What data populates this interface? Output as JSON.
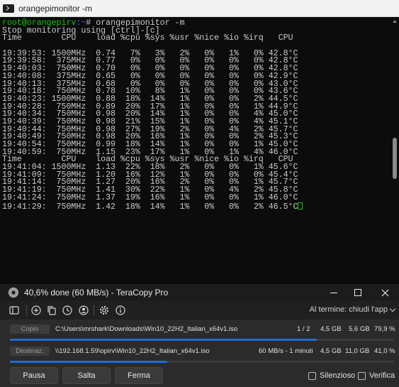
{
  "terminal": {
    "title": "orangepimonitor -m",
    "prompt_user": "root@orangepirv",
    "prompt_path": ":~",
    "prompt_symbol": "#",
    "command": "orangepimonitor -m",
    "lines": [
      "Stop monitoring using [ctrl]-[c]",
      "Time        CPU    load %cpu %sys %usr %nice %io %irq   CPU",
      "",
      "19:39:53: 1500MHz  0.74   7%   3%   2%   0%   1%   0% 42.8°C",
      "19:39:58:  375MHz  0.77   0%   0%   0%   0%   0%   0% 42.8°C",
      "19:40:03:  750MHz  0.70   0%   0%   0%   0%   0%   0% 42.8°C",
      "19:40:08:  375MHz  0.65   0%   0%   0%   0%   0%   0% 42.9°C",
      "19:40:13:  375MHz  0.68   0%   0%   0%   0%   0%   0% 43.0°C",
      "19:40:18:  750MHz  0.78  10%   8%   1%   0%   0%   0% 43.6°C",
      "19:40:23: 1500MHz  0.88  18%  14%   1%   0%   0%   2% 44.5°C",
      "19:40:28:  750MHz  0.89  20%  17%   1%   0%   0%   1% 44.9°C",
      "19:40:34:  750MHz  0.98  20%  14%   1%   0%   0%   4% 45.0°C",
      "19:40:39:  750MHz  0.98  21%  15%   1%   0%   0%   4% 45.1°C",
      "19:40:44:  750MHz  0.98  27%  19%   2%   0%   4%   2% 45.7°C",
      "19:40:49:  750MHz  0.98  20%  16%   1%   0%   0%   2% 45.3°C",
      "19:40:54:  750MHz  0.99  18%  14%   1%   0%   0%   1% 45.0°C",
      "19:40:59:  750MHz  1.15  23%  17%   1%   0%   1%   4% 46.0°C",
      "Time        CPU    load %cpu %sys %usr %nice %io %irq   CPU",
      "19:41:04: 1500MHz  1.13  22%  18%   2%   0%   0%   1% 45.6°C",
      "19:41:09:  750MHz  1.20  16%  12%   1%   0%   0%   0% 45.4°C",
      "19:41:14:  750MHz  1.27  20%  16%   2%   0%   0%   1% 45.7°C",
      "19:41:19:  750MHz  1.41  30%  22%   1%   0%   4%   2% 45.8°C",
      "19:41:24:  750MHz  1.37  19%  16%   1%   0%   0%   1% 46.0°C",
      "19:41:29:  750MHz  1.42  18%  14%   1%   0%   0%   2% 46.5°C"
    ]
  },
  "teracopy": {
    "title": "40,6% done (60 MB/s) - TeraCopy Pro",
    "toolbar_end_label": "Al termine: chiudi l'app",
    "source": {
      "badge": "Copio",
      "path": "C:\\Users\\mrshark\\Downloads\\Win10_22H2_Italian_x64v1.iso",
      "count": "1 / 2",
      "done": "4,5 GB",
      "total": "5,6 GB",
      "percent": "79,9 %",
      "progress": 0.799
    },
    "target": {
      "badge": "Destinaz.",
      "path": "\\\\192.168.1.59\\opirv\\Win10_22H2_Italian_x64v1.iso",
      "speed": "60 MB/s - 1 minuti",
      "done": "4,5 GB",
      "total": "11,0 GB",
      "percent": "41,0 %",
      "progress": 0.41
    },
    "buttons": {
      "pause": "Pausa",
      "skip": "Salta",
      "stop": "Ferma"
    },
    "checks": {
      "silent": "Silenzioso",
      "verify": "Verifica"
    }
  }
}
